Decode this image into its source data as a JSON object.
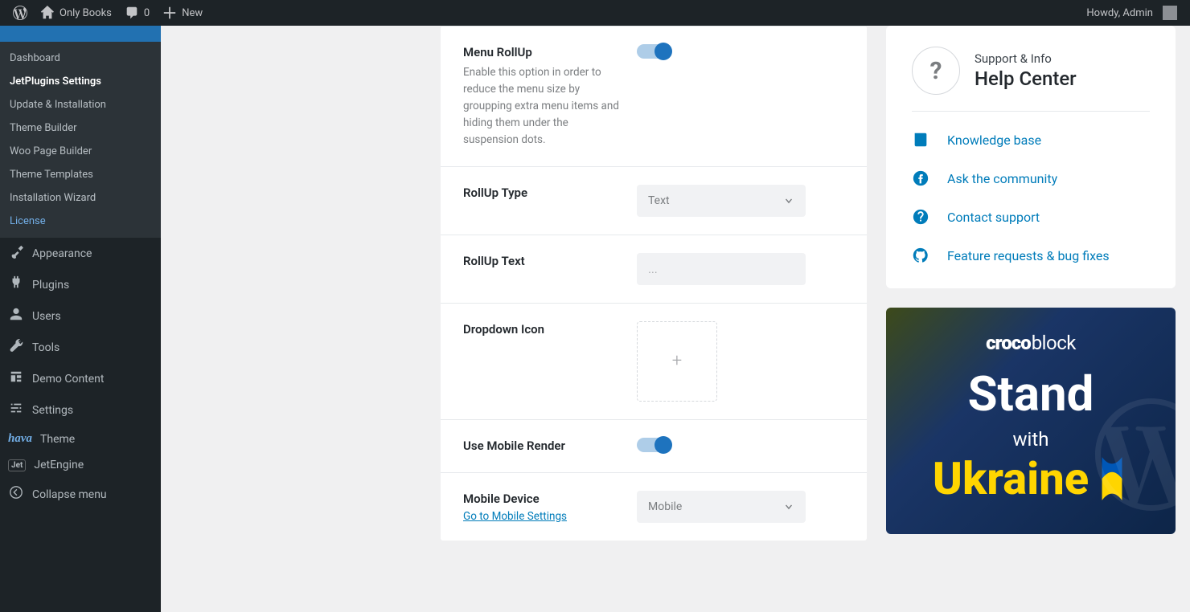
{
  "adminBar": {
    "siteName": "Only Books",
    "commentCount": "0",
    "newLabel": "New",
    "greeting": "Howdy, Admin"
  },
  "sidebar": {
    "submenu": [
      {
        "label": "Dashboard",
        "state": ""
      },
      {
        "label": "JetPlugins Settings",
        "state": "current"
      },
      {
        "label": "Update & Installation",
        "state": ""
      },
      {
        "label": "Theme Builder",
        "state": ""
      },
      {
        "label": "Woo Page Builder",
        "state": ""
      },
      {
        "label": "Theme Templates",
        "state": ""
      },
      {
        "label": "Installation Wizard",
        "state": ""
      },
      {
        "label": "License",
        "state": "highlight"
      }
    ],
    "items": [
      {
        "label": "Appearance",
        "icon": "brush"
      },
      {
        "label": "Plugins",
        "icon": "plug"
      },
      {
        "label": "Users",
        "icon": "user"
      },
      {
        "label": "Tools",
        "icon": "wrench"
      },
      {
        "label": "Demo Content",
        "icon": "demo"
      },
      {
        "label": "Settings",
        "icon": "sliders"
      }
    ],
    "theme": {
      "label": "Theme"
    },
    "jetEngine": {
      "label": "JetEngine"
    },
    "collapse": "Collapse menu"
  },
  "settings": {
    "menuRollup": {
      "label": "Menu RollUp",
      "desc": "Enable this option in order to reduce the menu size by groupping extra menu items and hiding them under the suspension dots."
    },
    "rollupType": {
      "label": "RollUp Type",
      "value": "Text"
    },
    "rollupText": {
      "label": "RollUp Text",
      "placeholder": "..."
    },
    "dropdownIcon": {
      "label": "Dropdown Icon"
    },
    "mobileRender": {
      "label": "Use Mobile Render"
    },
    "mobileDevice": {
      "label": "Mobile Device",
      "link": "Go to Mobile Settings",
      "value": "Mobile"
    }
  },
  "helpCenter": {
    "subtitle": "Support & Info",
    "title": "Help Center",
    "links": [
      {
        "icon": "book",
        "label": "Knowledge base"
      },
      {
        "icon": "facebook",
        "label": "Ask the community"
      },
      {
        "icon": "question",
        "label": "Contact support"
      },
      {
        "icon": "github",
        "label": "Feature requests & bug fixes"
      }
    ]
  },
  "banner": {
    "brand1": "croco",
    "brand2": "block",
    "line1": "Stand",
    "line2": "with",
    "line3": "Ukraine"
  }
}
